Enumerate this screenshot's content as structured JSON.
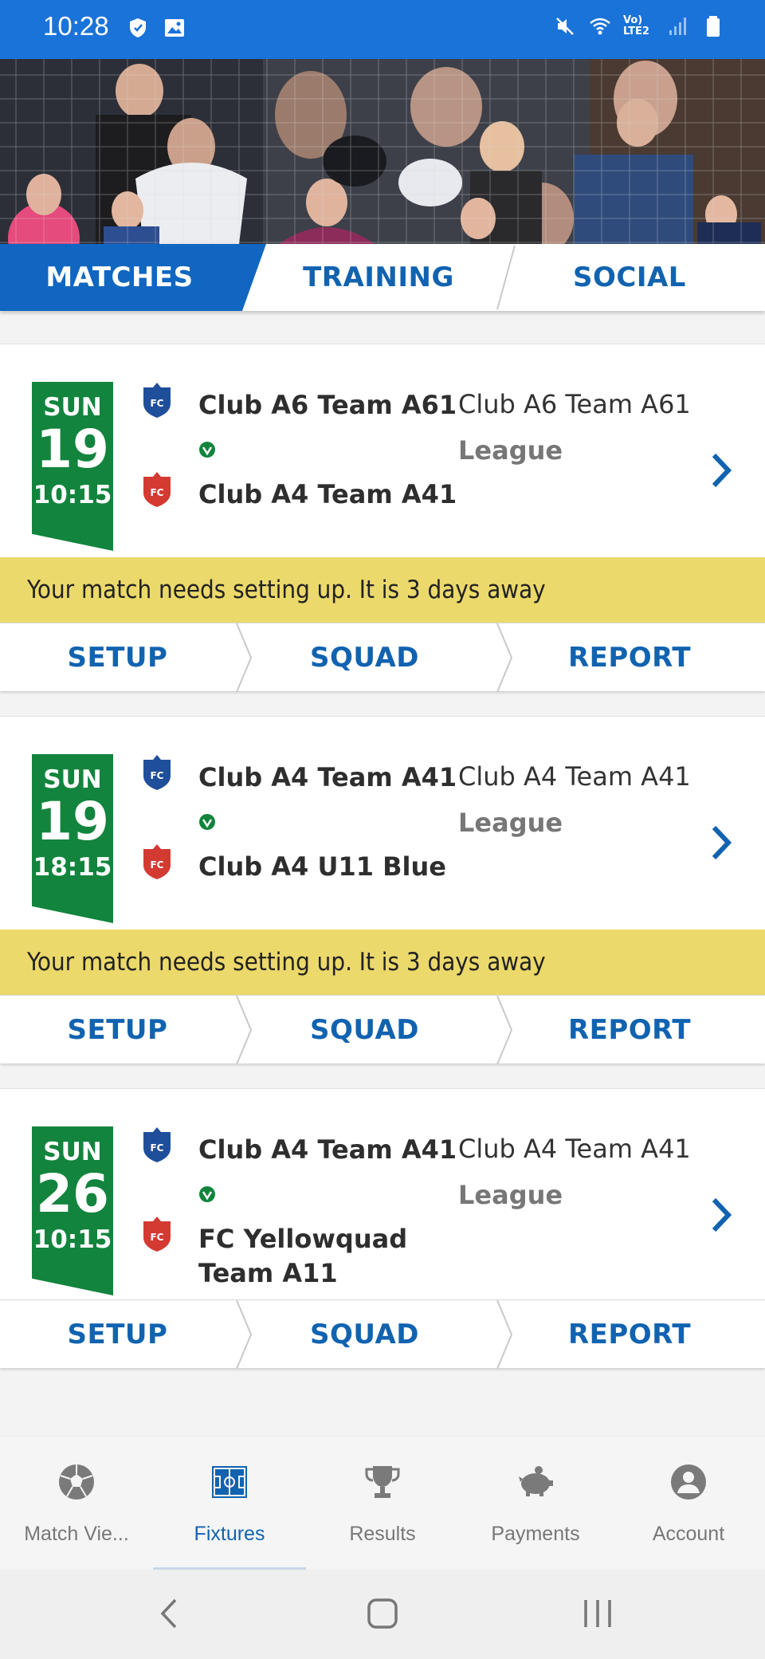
{
  "status_bar": {
    "time": "10:28",
    "right_label": "Vo) LTE2"
  },
  "tabs": [
    {
      "label": "MATCHES",
      "active": true
    },
    {
      "label": "TRAINING",
      "active": false
    },
    {
      "label": "SOCIAL",
      "active": false
    }
  ],
  "fixtures": [
    {
      "dow": "SUN",
      "day": "19",
      "time": "10:15",
      "home": "Club A6 Team A61",
      "away": "Club A4 Team A41",
      "venue": "Club A6 Team A61",
      "competition": "League",
      "notice": "Your match needs setting up. It is 3 days away",
      "actions": [
        "SETUP",
        "SQUAD",
        "REPORT"
      ]
    },
    {
      "dow": "SUN",
      "day": "19",
      "time": "18:15",
      "home": "Club A4 Team A41",
      "away": "Club A4 U11 Blue",
      "venue": "Club A4 Team A41",
      "competition": "League",
      "notice": "Your match needs setting up. It is 3 days away",
      "actions": [
        "SETUP",
        "SQUAD",
        "REPORT"
      ]
    },
    {
      "dow": "SUN",
      "day": "26",
      "time": "10:15",
      "home": "Club A4 Team A41",
      "away_line1": "FC Yellowquad",
      "away_line2": "Team A11",
      "venue": "Club A4 Team A41",
      "competition": "League",
      "actions": [
        "SETUP",
        "SQUAD",
        "REPORT"
      ]
    }
  ],
  "bottom_nav": [
    {
      "label": "Match Vie...",
      "icon": "football-icon"
    },
    {
      "label": "Fixtures",
      "icon": "pitch-icon",
      "active": true
    },
    {
      "label": "Results",
      "icon": "trophy-icon"
    },
    {
      "label": "Payments",
      "icon": "piggy-bank-icon"
    },
    {
      "label": "Account",
      "icon": "account-icon"
    }
  ],
  "colors": {
    "primary": "#1163b0",
    "status_bar": "#1a73d9",
    "date_badge": "#12843d",
    "notice": "#ecd96b",
    "crest_home": "#1f4f9a",
    "crest_away": "#d33a32"
  }
}
